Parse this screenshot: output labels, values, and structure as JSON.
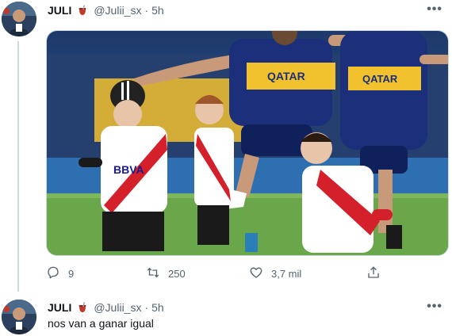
{
  "tweet": {
    "author_name": "JULI",
    "handle": "@Julii_sx",
    "separator": "·",
    "time": "5h",
    "more_label": "•••",
    "media_alt_text": {
      "shirt_sponsor_1": "QATAR",
      "shirt_sponsor_2": "QATAR",
      "kid_sponsor": "BBVA"
    },
    "stats": {
      "replies": "9",
      "retweets": "250",
      "likes": "3,7 mil"
    }
  },
  "reply": {
    "author_name": "JULI",
    "handle": "@Julii_sx",
    "separator": "·",
    "time": "5h",
    "more_label": "•••",
    "text": "nos van a ganar igual"
  },
  "colors": {
    "text_primary": "#0f1419",
    "text_secondary": "#536471",
    "border": "#cfd9de",
    "boca_blue": "#1b2f7a",
    "boca_gold": "#f2c12e",
    "river_red": "#d3202b"
  },
  "icons": [
    "mate-icon",
    "more-icon",
    "reply-icon",
    "retweet-icon",
    "like-icon",
    "share-icon"
  ]
}
